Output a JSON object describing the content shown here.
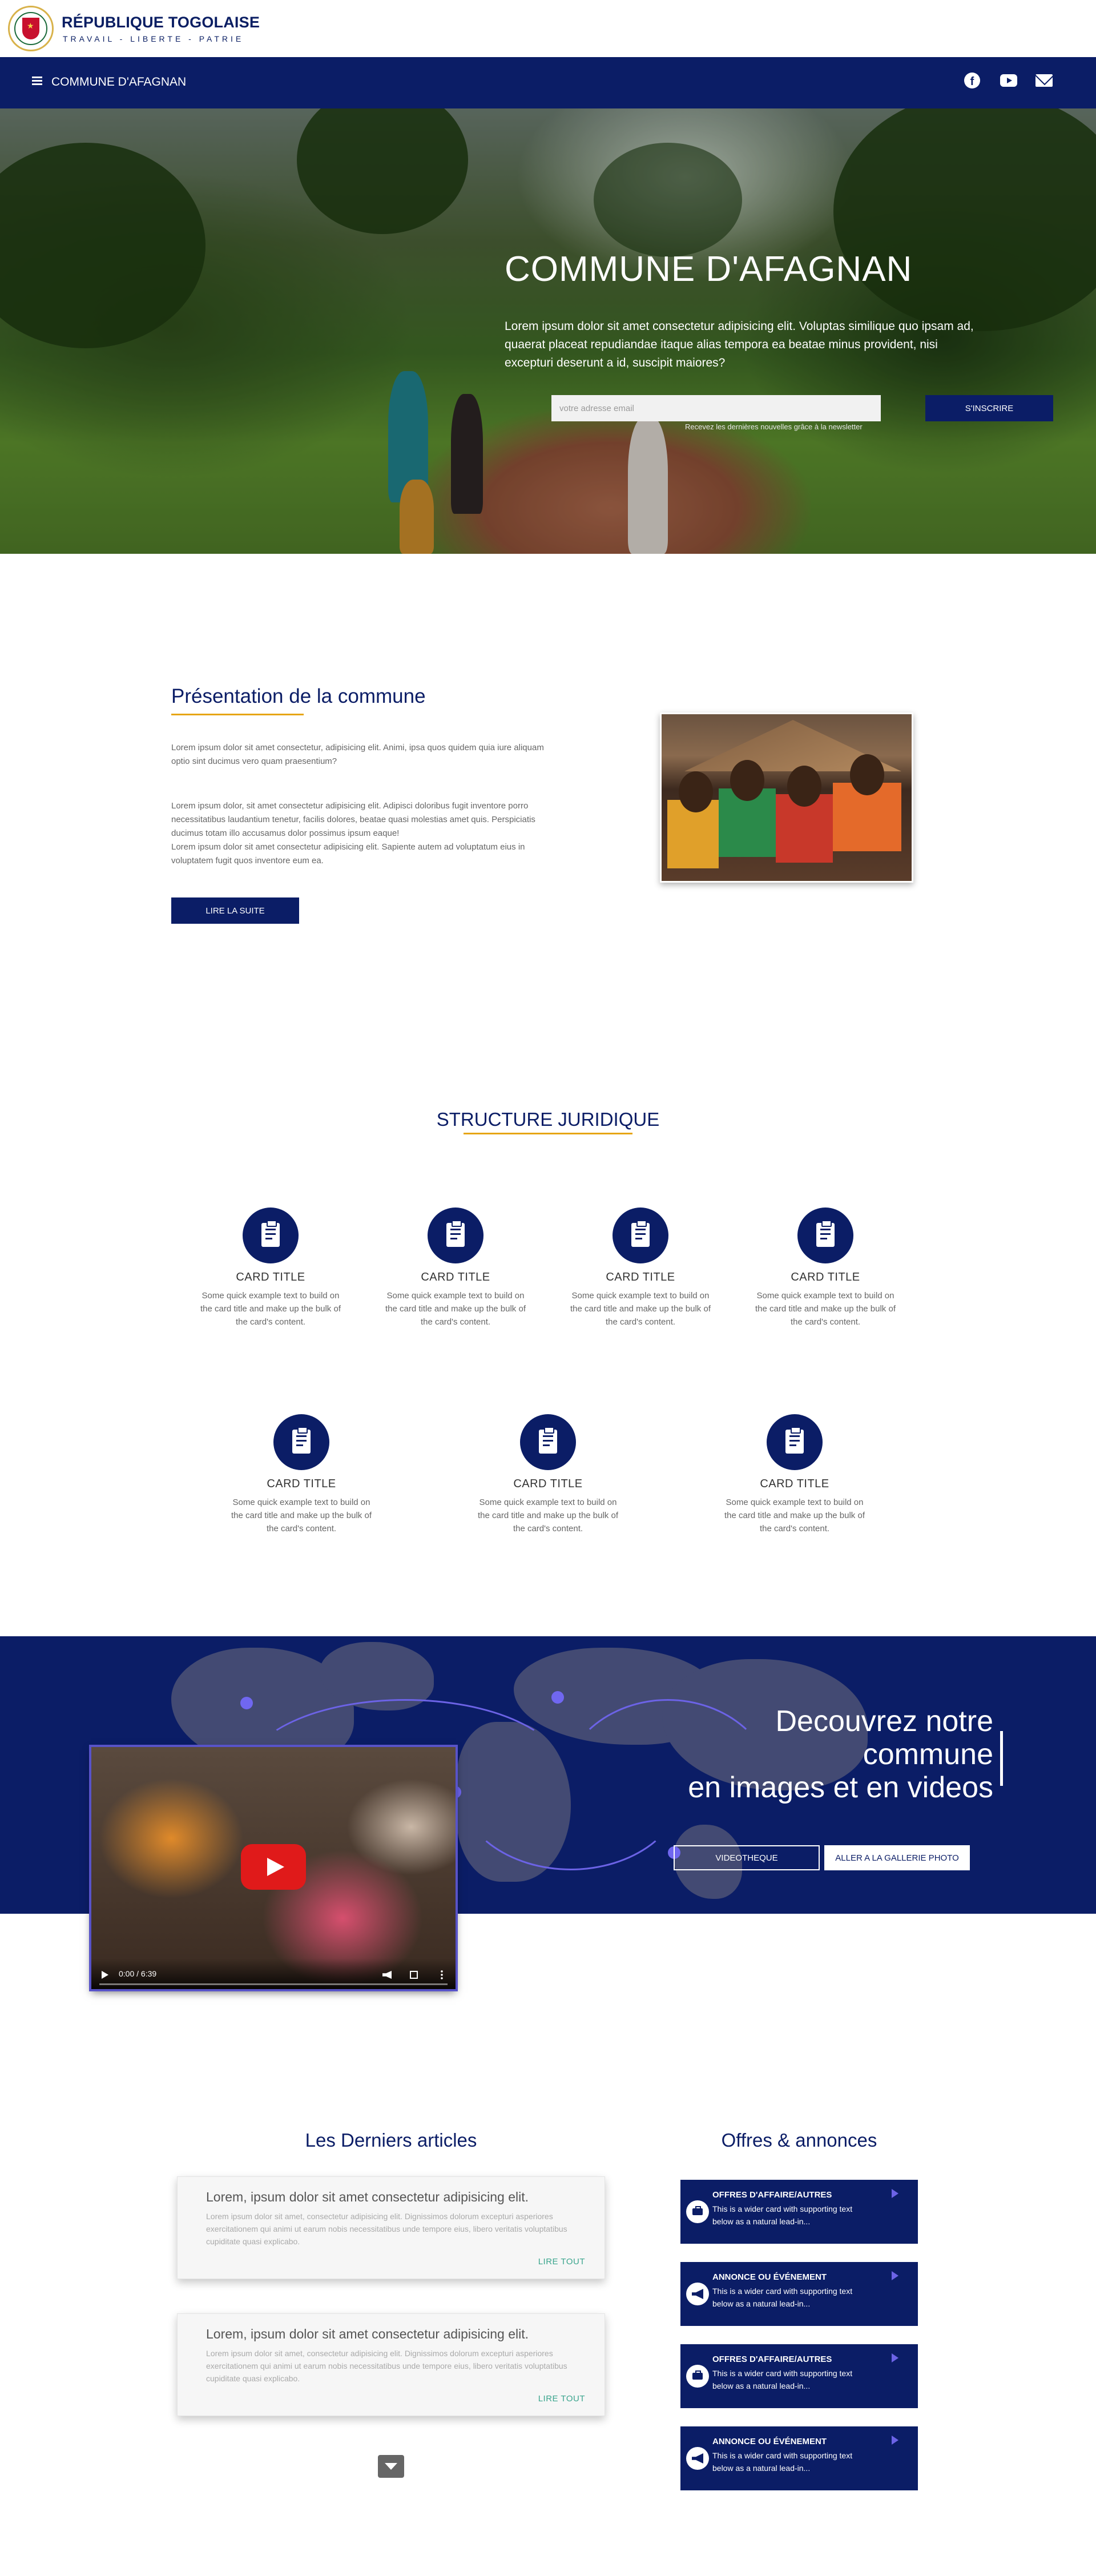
{
  "brand": {
    "title": "RÉPUBLIQUE TOGOLAISE",
    "motto": "TRAVAIL - LIBERTE - PATRIE"
  },
  "nav": {
    "title": "COMMUNE D'AFAGNAN",
    "social": [
      "facebook-icon",
      "youtube-icon",
      "mail-icon"
    ]
  },
  "hero": {
    "title": "COMMUNE D'AFAGNAN",
    "text": "Lorem ipsum dolor sit amet consectetur adipisicing elit. Voluptas similique quo ipsam ad, quaerat placeat repudiandae itaque alias tempora ea beatae minus provident, nisi excepturi deserunt a id, suscipit maiores?",
    "email_placeholder": "votre adresse email",
    "subscribe_label": "S'INSCRIRE",
    "note": "Recevez les dernières nouvelles grâce à la newsletter"
  },
  "presentation": {
    "title": "Présentation de la commune",
    "p1": "Lorem ipsum dolor sit amet consectetur, adipisicing elit. Animi, ipsa quos quidem quia iure aliquam optio sint ducimus vero quam praesentium?",
    "p2": "Lorem ipsum dolor, sit amet consectetur adipisicing elit. Adipisci doloribus fugit inventore porro necessitatibus laudantium tenetur, facilis dolores, beatae quasi molestias amet quis. Perspiciatis ducimus totam illo accusamus dolor possimus ipsum eaque!",
    "p3": "Lorem ipsum dolor sit amet consectetur adipisicing elit. Sapiente autem ad voluptatum eius in voluptatem fugit quos inventore eum ea.",
    "button": "LIRE LA SUITE"
  },
  "structure": {
    "title": "STRUCTURE JURIDIQUE",
    "cards": [
      {
        "title": "CARD TITLE",
        "text": "Some quick example text to build on the card title and make up the bulk of the card's content."
      },
      {
        "title": "CARD TITLE",
        "text": "Some quick example text to build on the card title and make up the bulk of the card's content."
      },
      {
        "title": "CARD TITLE",
        "text": "Some quick example text to build on the card title and make up the bulk of the card's content."
      },
      {
        "title": "CARD TITLE",
        "text": "Some quick example text to build on the card title and make up the bulk of the card's content."
      },
      {
        "title": "CARD TITLE",
        "text": "Some quick example text to build on the card title and make up the bulk of the card's content."
      },
      {
        "title": "CARD TITLE",
        "text": "Some quick example text to build on the card title and make up the bulk of the card's content."
      },
      {
        "title": "CARD TITLE",
        "text": "Some quick example text to build on the card title and make up the bulk of the card's content."
      }
    ]
  },
  "discover": {
    "line1": "Decouvrez notre",
    "line2": "commune",
    "line3": "en images et en videos",
    "video_button": "VIDEOTHEQUE",
    "gallery_button": "ALLER A LA GALLERIE PHOTO",
    "video_time": "0:00 / 6:39"
  },
  "articles": {
    "title": "Les Derniers articles",
    "items": [
      {
        "title": "Lorem, ipsum dolor sit amet consectetur adipisicing elit.",
        "body": "Lorem ipsum dolor sit amet, consectetur adipisicing elit. Dignissimos dolorum excepturi asperiores exercitationem qui animi ut earum nobis necessitatibus unde tempore eius, libero veritatis voluptatibus cupiditate quasi explicabo.",
        "link": "LIRE TOUT"
      },
      {
        "title": "Lorem, ipsum dolor sit amet consectetur adipisicing elit.",
        "body": "Lorem ipsum dolor sit amet, consectetur adipisicing elit. Dignissimos dolorum excepturi asperiores exercitationem qui animi ut earum nobis necessitatibus unde tempore eius, libero veritatis voluptatibus cupiditate quasi explicabo.",
        "link": "LIRE TOUT"
      }
    ]
  },
  "offers": {
    "title": "Offres & annonces",
    "items": [
      {
        "title": "OFFRES D'AFFAIRE/AUTRES",
        "text": "This is a wider card with supporting text below as a natural lead-in...",
        "icon": "briefcase-icon"
      },
      {
        "title": "ANNONCE OU ÉVÉNEMENT",
        "text": "This is a wider card with supporting text below as a natural lead-in...",
        "icon": "megaphone-icon"
      },
      {
        "title": "OFFRES D'AFFAIRE/AUTRES",
        "text": "This is a wider card with supporting text below as a natural lead-in...",
        "icon": "briefcase-icon"
      },
      {
        "title": "ANNONCE OU ÉVÉNEMENT",
        "text": "This is a wider card with supporting text below as a natural lead-in...",
        "icon": "megaphone-icon"
      }
    ]
  },
  "colors": {
    "navy": "#0b1d66",
    "accent": "#e6a514",
    "purple": "#6c63e6",
    "link": "#3aa58d"
  }
}
